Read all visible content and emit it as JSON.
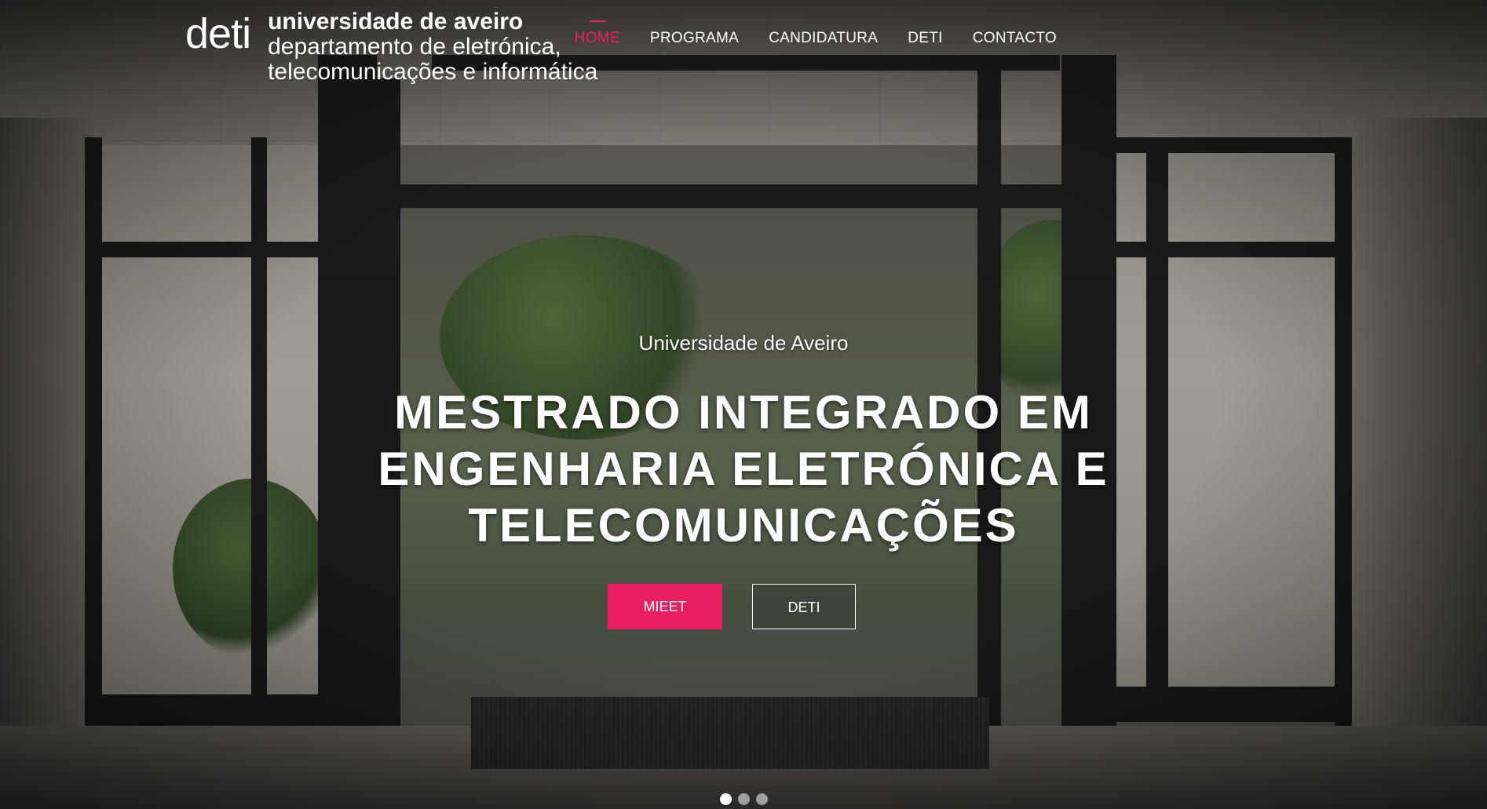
{
  "logo": {
    "mark": "deti",
    "line1": "universidade de aveiro",
    "line2": "departamento de eletrónica,",
    "line3": "telecomunicações e informática"
  },
  "nav": {
    "items": [
      {
        "label": "HOME",
        "active": true
      },
      {
        "label": "PROGRAMA",
        "active": false
      },
      {
        "label": "CANDIDATURA",
        "active": false
      },
      {
        "label": "DETI",
        "active": false
      },
      {
        "label": "CONTACTO",
        "active": false
      }
    ]
  },
  "hero": {
    "subtitle": "Universidade de Aveiro",
    "title": "MESTRADO INTEGRADO EM ENGENHARIA ELETRÓNICA E TELECOMUNICAÇÕES",
    "primary_button": "MIEET",
    "secondary_button": "DETI"
  },
  "carousel": {
    "slides": 3,
    "active_index": 0
  },
  "colors": {
    "accent": "#e91e63",
    "text": "#ffffff"
  }
}
